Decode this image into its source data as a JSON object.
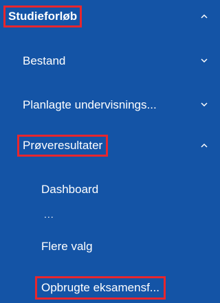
{
  "nav": {
    "section": {
      "label": "Studieforløb",
      "expanded": true
    },
    "items": [
      {
        "label": "Bestand",
        "expanded": false
      },
      {
        "label": "Planlagte undervisnings...",
        "expanded": false
      },
      {
        "label": "Prøveresultater",
        "expanded": true
      }
    ],
    "subitems": [
      {
        "label": "Dashboard"
      },
      {
        "label": "..."
      },
      {
        "label": "Flere valg"
      },
      {
        "label": "Opbrugte eksamensf..."
      }
    ]
  },
  "colors": {
    "background": "#1454a6",
    "text": "#ffffff",
    "highlight": "#e8262d"
  },
  "icons": {
    "expanded": "chevron-up-icon",
    "collapsed": "chevron-down-icon"
  }
}
